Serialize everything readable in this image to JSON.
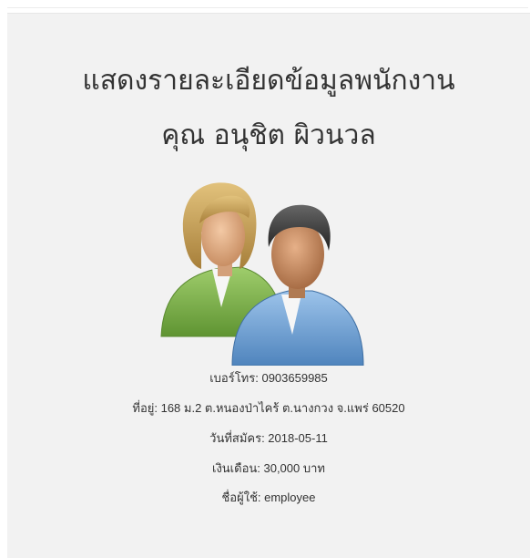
{
  "header": {
    "title_line1": "แสดงรายละเอียดข้อมูลพนักงาน",
    "title_line2": "คุณ อนุชิต ผิวนวล"
  },
  "avatar": {
    "icon": "employees-icon",
    "colors": {
      "woman_shirt": "#7fb34a",
      "man_shirt": "#6a9ed4",
      "woman_hair": "#c8a25a",
      "man_hair": "#3a3a3a",
      "skin": "#d9a57a"
    }
  },
  "details": {
    "phone": "เบอร์โทร: 0903659985",
    "address": "ที่อยู่: 168 ม.2 ต.หนองป่าไคร้ ต.นางกวง จ.แพร่ 60520",
    "start_date": "วันที่สมัคร: 2018-05-11",
    "salary": "เงินเดือน: 30,000 บาท",
    "username": "ชื่อผู้ใช้: employee"
  }
}
